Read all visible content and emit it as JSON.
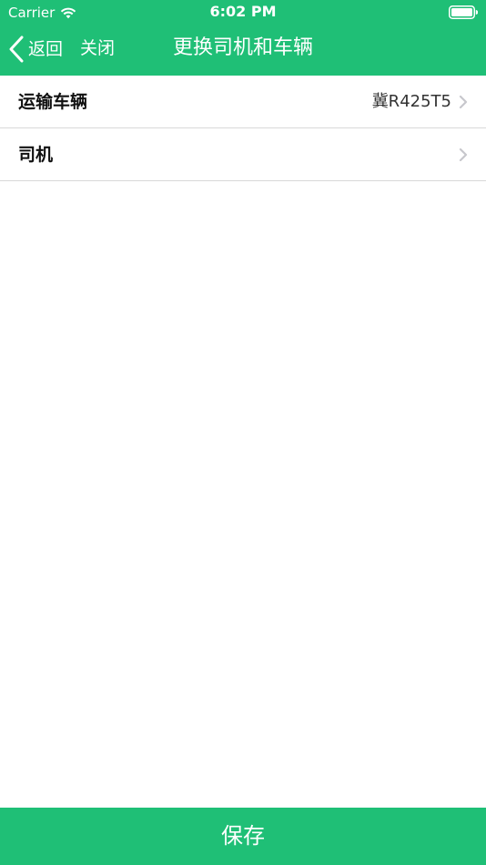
{
  "status_bar": {
    "carrier": "Carrier",
    "time": "6:02 PM",
    "wifi_icon": "wifi-icon",
    "battery_icon": "battery-icon"
  },
  "nav": {
    "back_label": "返回",
    "back_icon": "chevron-left-icon",
    "close_label": "关闭",
    "title": "更换司机和车辆"
  },
  "rows": [
    {
      "label": "运输车辆",
      "value": "冀R425T5",
      "icon": "chevron-right-icon"
    },
    {
      "label": "司机",
      "value": "",
      "icon": "chevron-right-icon"
    }
  ],
  "save_label": "保存",
  "colors": {
    "brand": "#1fbf76",
    "divider": "#d8d8d8",
    "chevron": "#c7c7cc"
  }
}
